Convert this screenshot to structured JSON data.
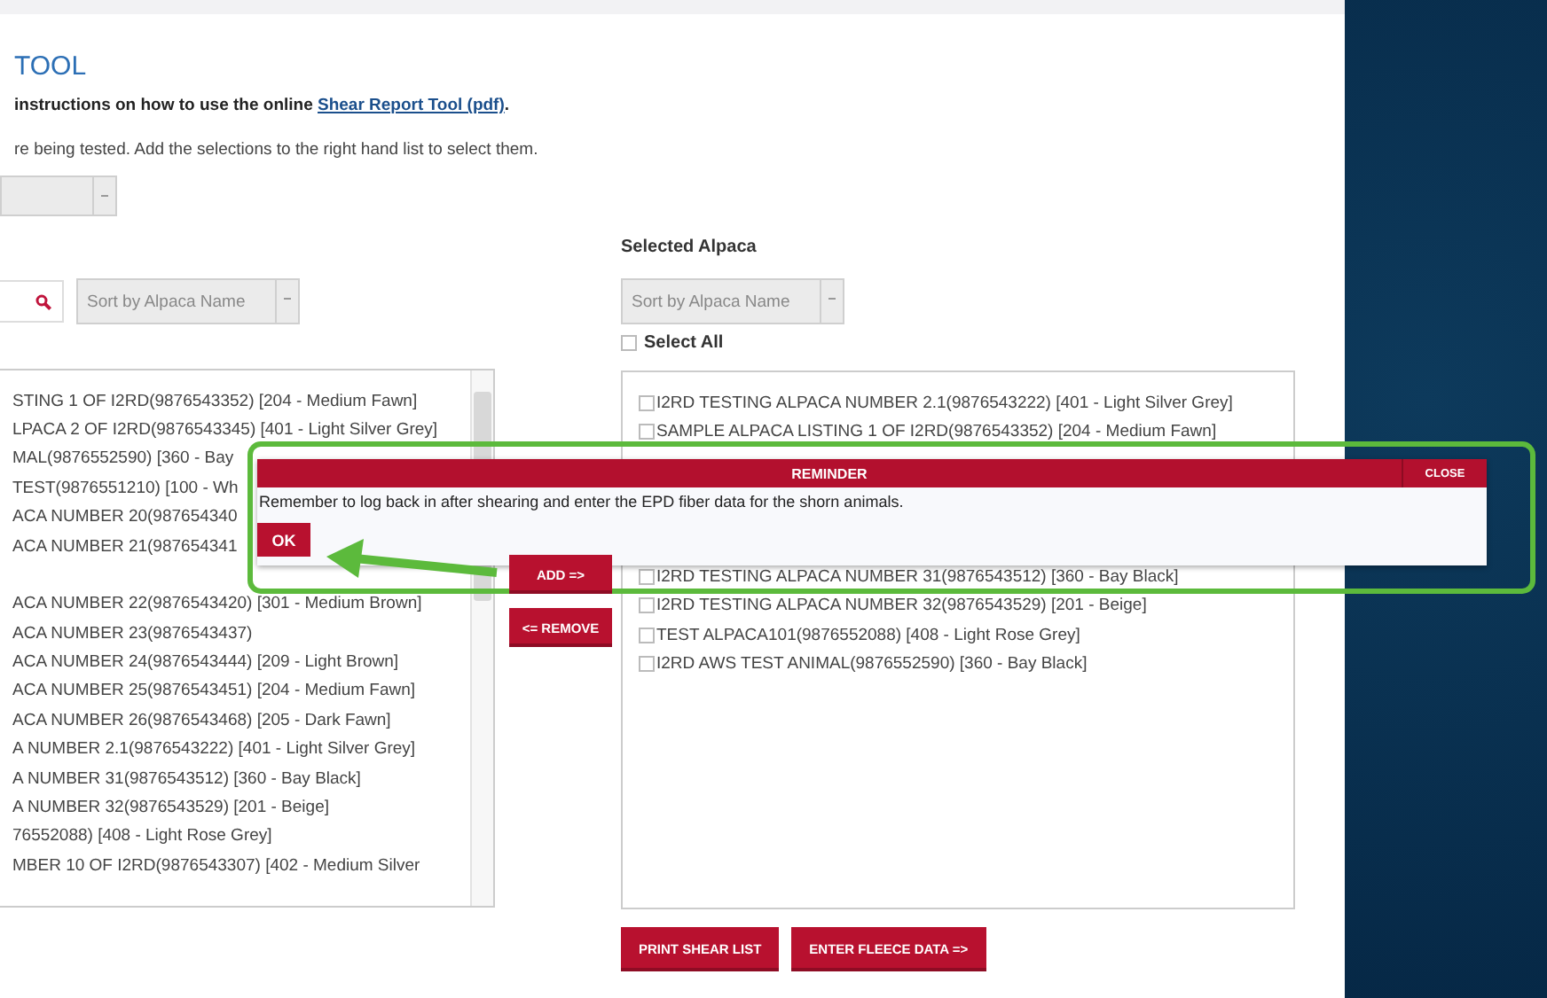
{
  "page": {
    "title": "TOOL",
    "instructions": {
      "before": "instructions on how to use the online ",
      "link": "Shear Report Tool (pdf)",
      "after": "."
    },
    "hint": "re being tested. Add the selections to the right hand list to select them."
  },
  "left_sort": {
    "value": "Sort by Alpaca Name"
  },
  "available": [
    "STING 1 OF I2RD(9876543352) [204 - Medium Fawn]",
    "LPACA 2 OF I2RD(9876543345) [401 - Light Silver Grey]",
    "MAL(9876552590) [360 - Bay",
    "TEST(9876551210) [100 - Wh",
    "ACA NUMBER 20(987654340",
    "ACA NUMBER 21(987654341",
    "ACA NUMBER 22(9876543420) [301 - Medium Brown]",
    "ACA NUMBER 23(9876543437)",
    "ACA NUMBER 24(9876543444) [209 - Light Brown]",
    "ACA NUMBER 25(9876543451) [204 - Medium Fawn]",
    "ACA NUMBER 26(9876543468) [205 - Dark Fawn]",
    "A NUMBER 2.1(9876543222) [401 - Light Silver Grey]",
    "A NUMBER 31(9876543512) [360 - Bay Black]",
    "A NUMBER 32(9876543529) [201 - Beige]",
    "76552088) [408 - Light Rose Grey]",
    "MBER 10 OF I2RD(9876543307) [402 - Medium Silver"
  ],
  "add_button": "ADD =>",
  "remove_button": "<= REMOVE",
  "selected_heading": "Selected Alpaca",
  "right_sort": {
    "value": "Sort by Alpaca Name"
  },
  "select_all": {
    "label": "Select All",
    "checked": false
  },
  "selected": [
    {
      "text": "I2RD TESTING ALPACA NUMBER 2.1(9876543222) [401 - Light Silver Grey]",
      "checked": false
    },
    {
      "text": "SAMPLE ALPACA LISTING 1 OF I2RD(9876543352) [204 - Medium Fawn]",
      "checked": false
    },
    {
      "text": "I2RD TESTING ALPACA NUMBER 31(9876543512) [360 - Bay Black]",
      "checked": false
    },
    {
      "text": "I2RD TESTING ALPACA NUMBER 32(9876543529) [201 - Beige]",
      "checked": false
    },
    {
      "text": "TEST ALPACA101(9876552088) [408 - Light Rose Grey]",
      "checked": false
    },
    {
      "text": "I2RD AWS TEST ANIMAL(9876552590) [360 - Bay Black]",
      "checked": false
    }
  ],
  "footer_buttons": [
    "PRINT SHEAR LIST",
    "ENTER FLEECE DATA =>"
  ],
  "dialog": {
    "title": "REMINDER",
    "close": "CLOSE",
    "message": "Remember to log back in after shearing and enter the EPD fiber data for the shorn animals.",
    "ok": "OK"
  }
}
